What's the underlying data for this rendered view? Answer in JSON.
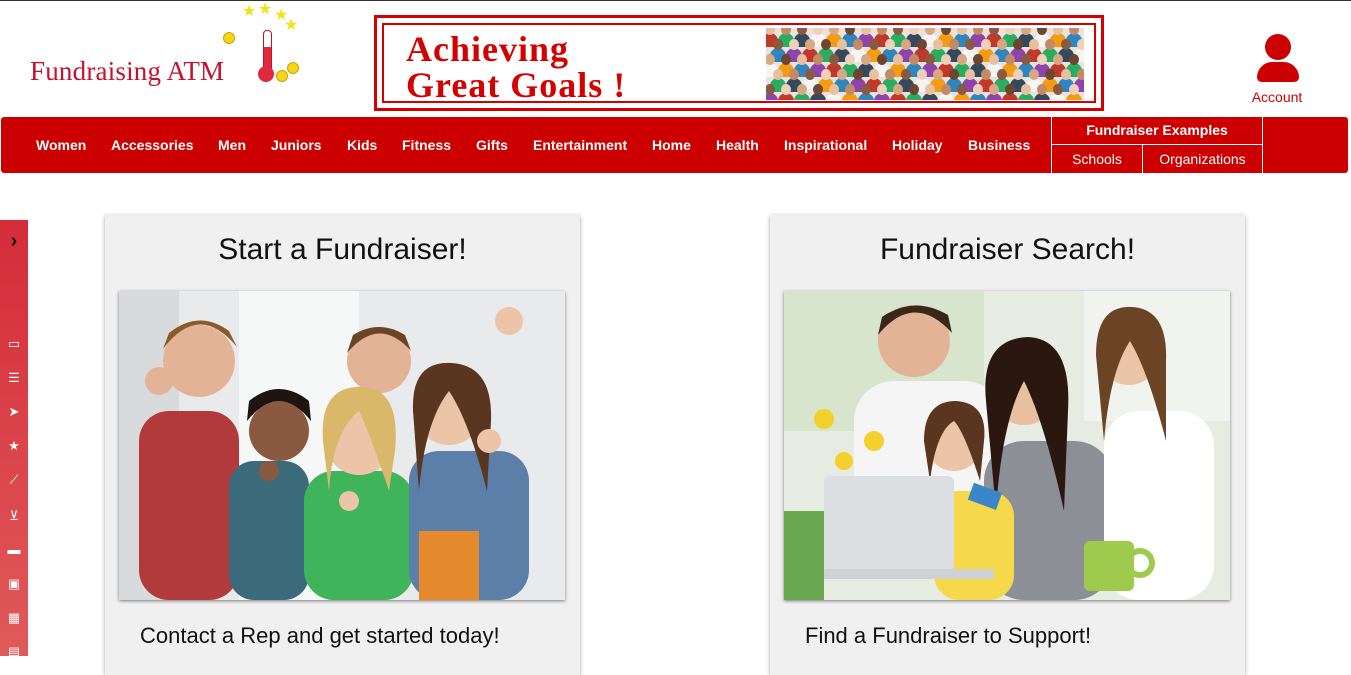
{
  "logo": {
    "text": "Fundraising ATM"
  },
  "banner": {
    "line1": "Achieving",
    "line2": "Great Goals !"
  },
  "account": {
    "label": "Account"
  },
  "nav": {
    "items": [
      "Women",
      "Accessories",
      "Men",
      "Juniors",
      "Kids",
      "Fitness",
      "Gifts",
      "Entertainment",
      "Home",
      "Health",
      "Inspirational",
      "Holiday",
      "Business"
    ],
    "examples_title": "Fundraiser Examples",
    "examples": [
      "Schools",
      "Organizations"
    ]
  },
  "sidebar": {
    "icons": [
      "chevron-right-icon",
      "monitor-icon",
      "list-icon",
      "cursor-icon",
      "star-icon",
      "chart-line-icon",
      "cart-icon",
      "truck-icon",
      "money-icon",
      "calculator-icon",
      "calendar-icon"
    ]
  },
  "cards": [
    {
      "title": "Start a Fundraiser!",
      "caption": "Contact a Rep and get started today!"
    },
    {
      "title": "Fundraiser Search!",
      "caption": "Find a Fundraiser to Support!"
    }
  ],
  "colors": {
    "brand_red": "#cc0000",
    "banner_red": "#d40000",
    "card_bg": "#f0f0f0"
  }
}
